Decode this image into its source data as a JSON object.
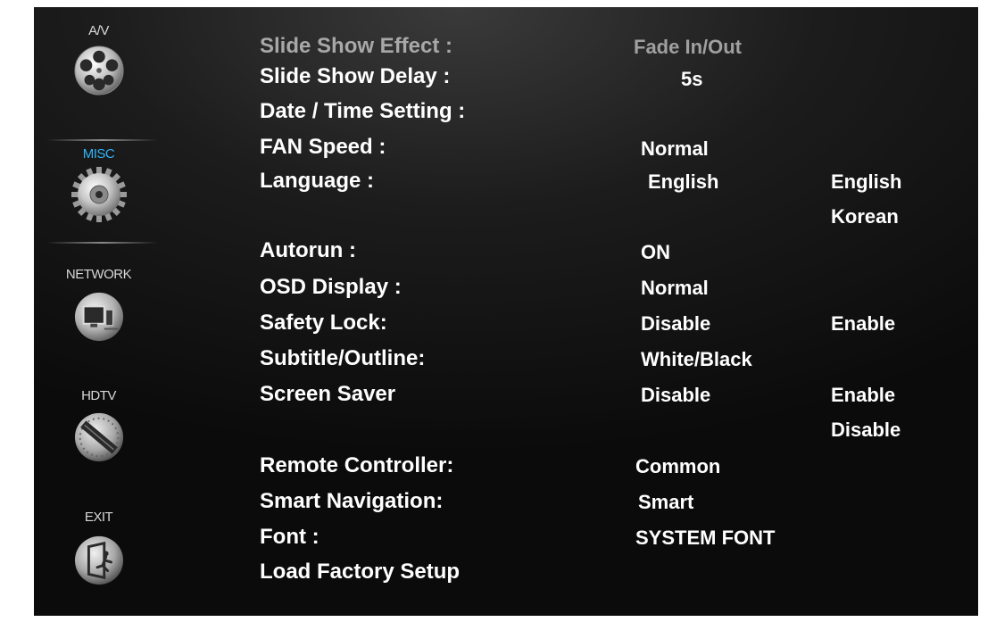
{
  "sidebar": {
    "items": [
      {
        "label": "A/V",
        "icon": "film-reel-icon"
      },
      {
        "label": "MISC",
        "icon": "gear-disc-icon",
        "active": true
      },
      {
        "label": "NETWORK",
        "icon": "monitor-icon"
      },
      {
        "label": "HDTV",
        "icon": "hdtv-dial-icon"
      },
      {
        "label": "EXIT",
        "icon": "exit-door-icon"
      }
    ]
  },
  "menu": {
    "rows": [
      {
        "label": "Slide Show Effect :",
        "value": "Fade In/Out"
      },
      {
        "label": "Slide Show Delay :",
        "value": "5s"
      },
      {
        "label": "Date / Time Setting :",
        "value": ""
      },
      {
        "label": "FAN Speed :",
        "value": "Normal"
      },
      {
        "label": "Language :",
        "value": "English",
        "options": [
          "English",
          "Korean"
        ]
      },
      {
        "label": "Autorun :",
        "value": "ON"
      },
      {
        "label": "OSD Display :",
        "value": "Normal"
      },
      {
        "label": "Safety Lock:",
        "value": "Disable",
        "options": [
          "Enable"
        ]
      },
      {
        "label": "Subtitle/Outline:",
        "value": "White/Black"
      },
      {
        "label": "Screen Saver",
        "value": "Disable",
        "options": [
          "Enable",
          "Disable"
        ]
      },
      {
        "label": "Remote Controller:",
        "value": "Common"
      },
      {
        "label": "Smart Navigation:",
        "value": "Smart"
      },
      {
        "label": "Font :",
        "value": "SYSTEM FONT"
      },
      {
        "label": "Load Factory Setup",
        "value": ""
      }
    ]
  },
  "colors": {
    "accent": "#32b3f5",
    "background": "#0b0b0b",
    "text": "#ffffff",
    "dim_text": "#a8a8a8"
  }
}
